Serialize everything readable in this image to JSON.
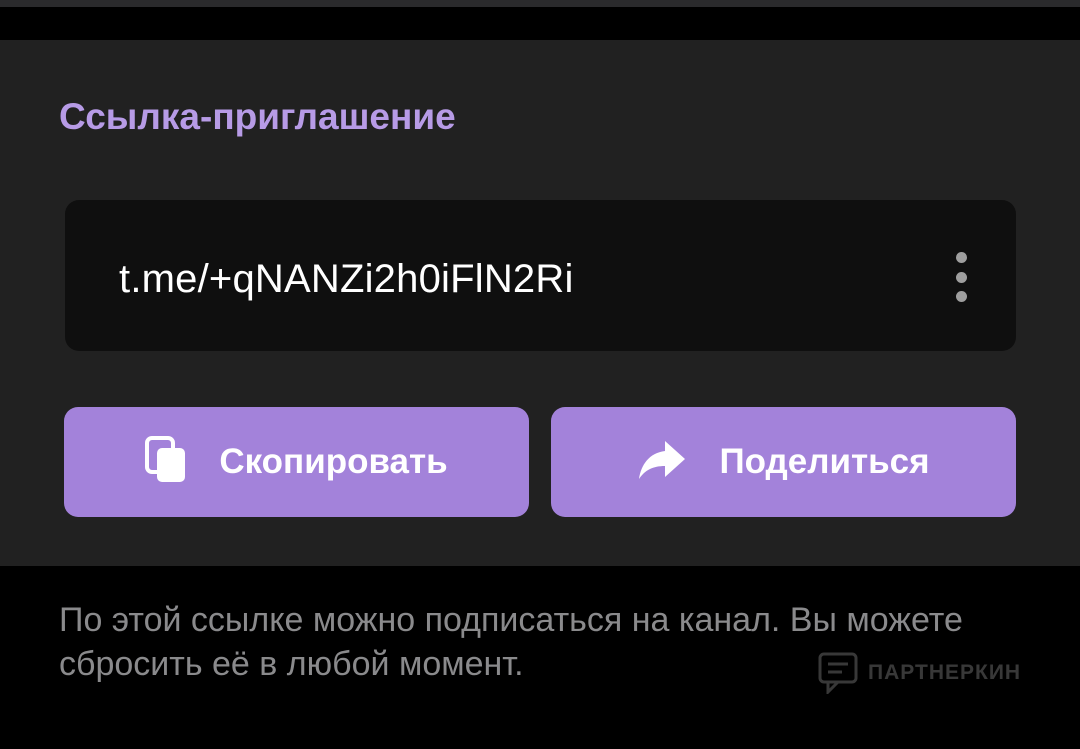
{
  "section": {
    "title": "Ссылка-приглашение"
  },
  "invite_link": {
    "value": "t.me/+qNANZi2h0iFlN2Ri"
  },
  "buttons": {
    "copy_label": "Скопировать",
    "share_label": "Поделиться"
  },
  "footer": {
    "description": "По этой ссылке можно подписаться на канал. Вы можете сбросить её в любой момент."
  },
  "watermark": {
    "text": "ПАРТНЕРКИН"
  },
  "icons": {
    "more": "more-vertical-icon",
    "copy": "copy-icon",
    "share": "share-arrow-icon",
    "watermark": "chat-bubble-logo"
  },
  "colors": {
    "accent": "#a382da",
    "title": "#b79be6",
    "card_bg": "#212121",
    "link_bg": "#0f0f0f",
    "page_bg": "#000000",
    "muted_text": "#8a8a8c"
  }
}
